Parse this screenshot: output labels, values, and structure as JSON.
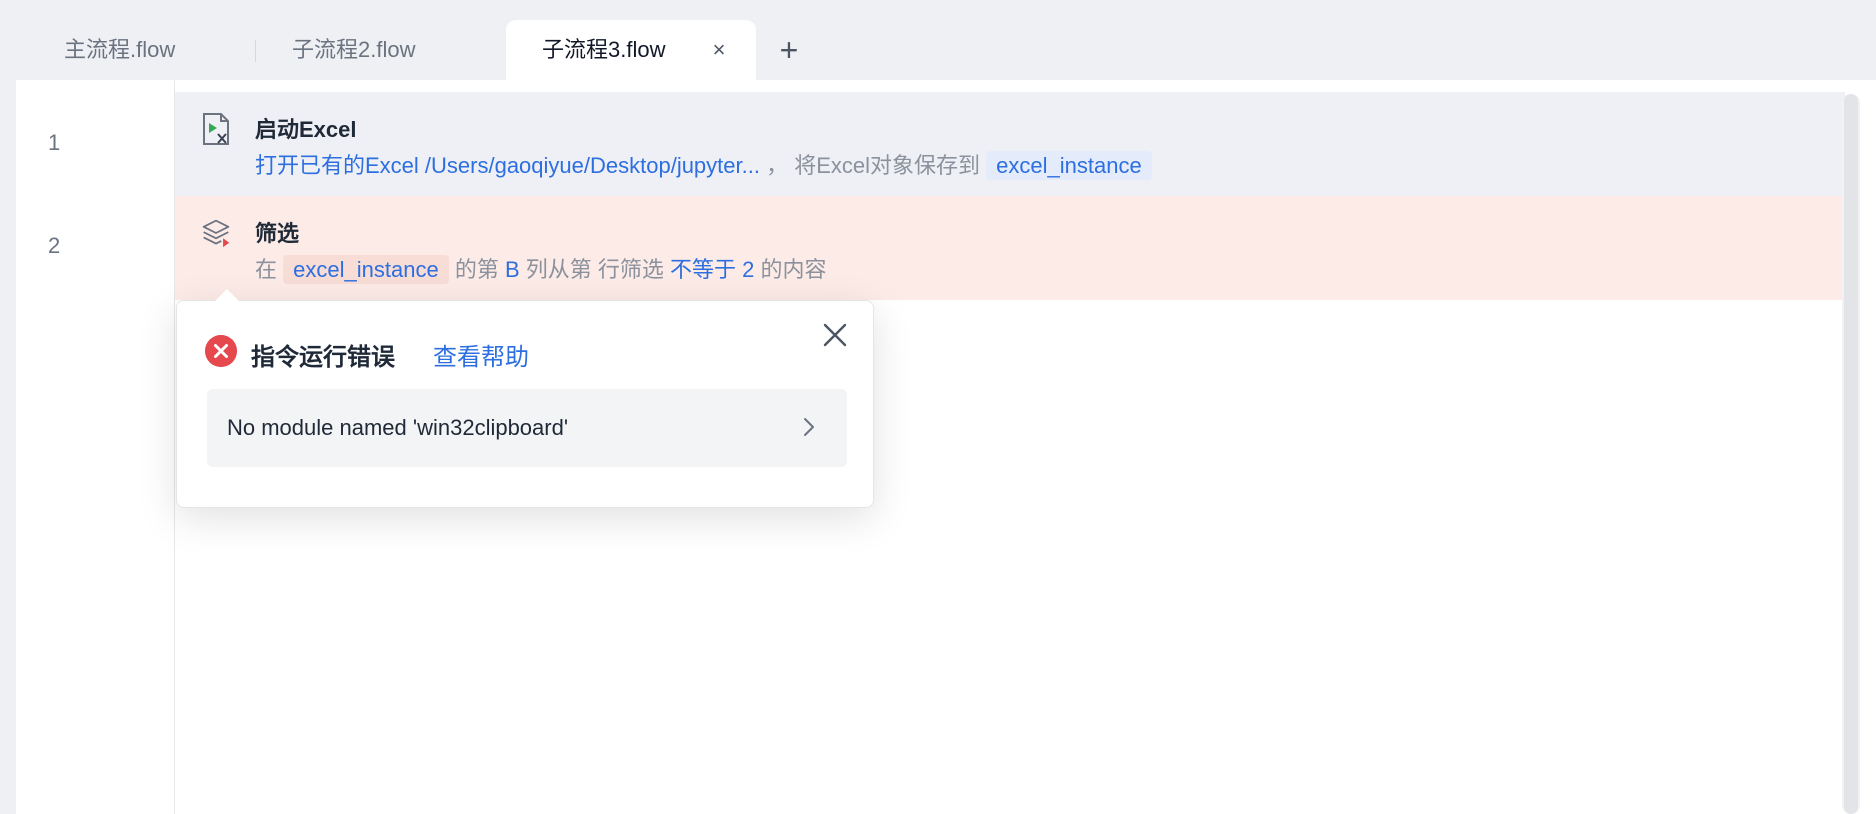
{
  "tabs": [
    {
      "label": "主流程.flow",
      "active": false
    },
    {
      "label": "子流程2.flow",
      "active": false
    },
    {
      "label": "子流程3.flow",
      "active": true
    }
  ],
  "tab_close_glyph": "×",
  "add_tab_glyph": "+",
  "line_numbers": [
    "1",
    "2"
  ],
  "rows": [
    {
      "icon": "excel-launch-icon",
      "title": "启动Excel",
      "desc": {
        "part1": "打开已有的Excel /Users/gaoqiyue/Desktop/jupyter...",
        "part2": "， 将Excel对象保存到",
        "var": "excel_instance"
      }
    },
    {
      "icon": "layers-filter-icon",
      "title": "筛选",
      "desc": {
        "p1": "在",
        "var": "excel_instance",
        "p2": "的第",
        "col": "B",
        "p3": "列从第 行筛选",
        "op": "不等于",
        "val": "2",
        "p4": "的内容"
      }
    }
  ],
  "error_popover": {
    "title": "指令运行错误",
    "help_link": "查看帮助",
    "message": "No module named 'win32clipboard'",
    "icon": "error-circle-icon"
  },
  "colors": {
    "accent": "#2d6fe0",
    "error": "#e5484d",
    "error_row_bg": "#fcebe7",
    "selected_row_bg": "#eef0f5"
  }
}
